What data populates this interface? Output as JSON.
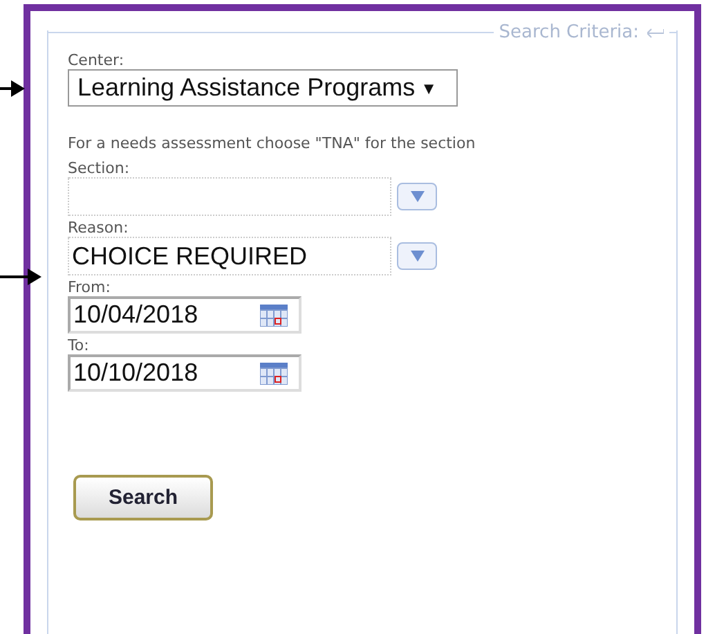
{
  "panel": {
    "legend": "Search Criteria:"
  },
  "fields": [
    {
      "kind": "select",
      "label": "Center:",
      "value": "Learning Assistance Programs",
      "caret": "▼",
      "annotated": true
    },
    {
      "kind": "note",
      "text": "For a needs assessment choose \"TNA\" for the section"
    },
    {
      "kind": "combo",
      "label": "Section:",
      "annotated": false
    },
    {
      "kind": "combo",
      "label": "Reason:",
      "value": "CHOICE REQUIRED",
      "annotated": true
    },
    {
      "kind": "date",
      "label": "From:",
      "value": "10/04/2018"
    },
    {
      "kind": "date",
      "label": "To:",
      "value": "10/10/2018"
    }
  ],
  "search_button": "Search"
}
